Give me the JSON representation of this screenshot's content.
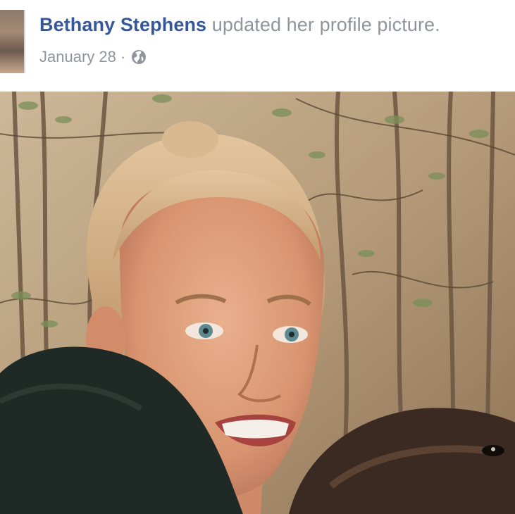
{
  "post": {
    "author_name": "Bethany Stephens",
    "action_text": "updated her profile picture.",
    "date": "January 28",
    "separator": "·",
    "privacy_icon": "globe-icon"
  },
  "colors": {
    "author_link": "#365899",
    "meta_text": "#90949c"
  }
}
